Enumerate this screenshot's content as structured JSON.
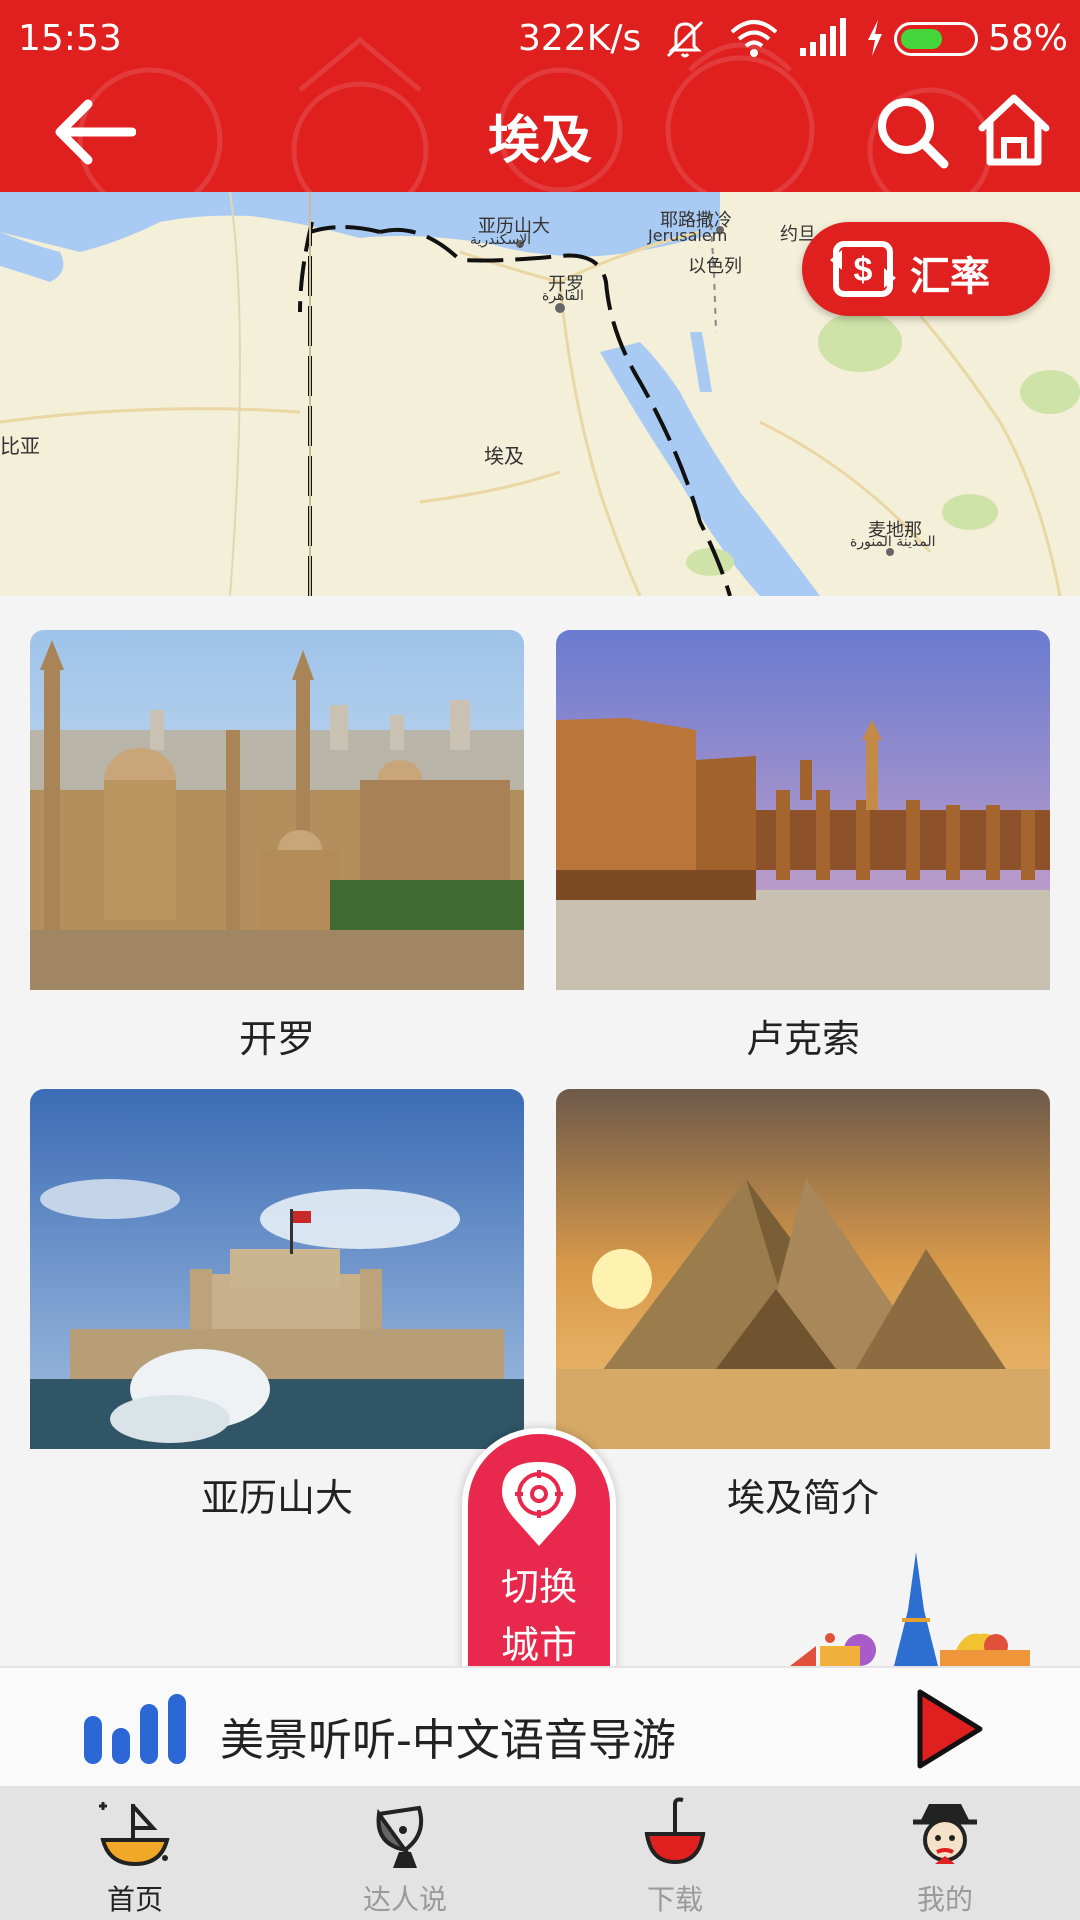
{
  "status_bar": {
    "time": "15:53",
    "network_speed": "322K/s",
    "battery_percent": "58%",
    "battery_level": 0.58,
    "icons": [
      "mute-icon",
      "wifi-icon",
      "signal-icon",
      "charging-icon",
      "battery-icon"
    ]
  },
  "header": {
    "title": "埃及",
    "back_icon": "back-arrow-icon",
    "search_icon": "search-icon",
    "home_icon": "home-icon",
    "background_color": "#e01f1f"
  },
  "map": {
    "labels": {
      "alexandria_cn": "亚历山大",
      "alexandria_ar": "الإسكندرية",
      "jerusalem_cn": "耶路撒冷",
      "jerusalem_en": "Jerusalem",
      "jordan": "约旦",
      "israel": "以色列",
      "cairo_cn": "开罗",
      "cairo_ar": "القاهرة",
      "libya": "利比亚",
      "egypt": "埃及",
      "medina_cn": "麦地那",
      "medina_ar": "المدينة المنورة"
    },
    "exchange_button": {
      "label": "汇率",
      "icon": "currency-exchange-icon"
    }
  },
  "cities": [
    {
      "name": "开罗"
    },
    {
      "name": "卢克索"
    },
    {
      "name": "亚历山大"
    },
    {
      "name": "埃及简介"
    }
  ],
  "switch_city": {
    "line1": "切换",
    "line2": "城市",
    "icon": "location-pin-icon"
  },
  "audio_guide": {
    "title": "美景听听-中文语音导游",
    "icon": "audio-bars-icon",
    "play_icon": "play-icon"
  },
  "bottom_nav": {
    "items": [
      {
        "label": "首页",
        "icon": "home-boat-icon",
        "active": true
      },
      {
        "label": "达人说",
        "icon": "satellite-dish-icon",
        "active": false
      },
      {
        "label": "下载",
        "icon": "download-bowl-icon",
        "active": false
      },
      {
        "label": "我的",
        "icon": "profile-face-icon",
        "active": false
      }
    ]
  },
  "colors": {
    "brand_red": "#e01f1f",
    "switch_pink": "#e8284c",
    "battery_green": "#45d63c"
  }
}
